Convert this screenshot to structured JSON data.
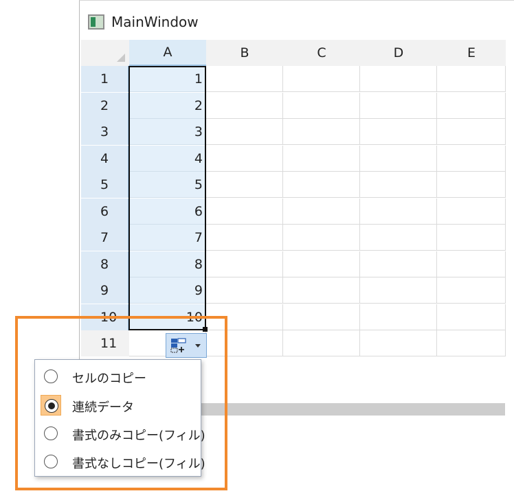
{
  "window": {
    "title": "MainWindow"
  },
  "sheet": {
    "columns": [
      "A",
      "B",
      "C",
      "D",
      "E"
    ],
    "rows": [
      "1",
      "2",
      "3",
      "4",
      "5",
      "6",
      "7",
      "8",
      "9",
      "10",
      "11"
    ],
    "column_a_values": [
      "1",
      "2",
      "3",
      "4",
      "5",
      "6",
      "7",
      "8",
      "9",
      "10"
    ],
    "selected_column": "A"
  },
  "autofill": {
    "button_icon": "autofill-options-icon",
    "options": [
      {
        "label": "セルのコピー",
        "checked": false
      },
      {
        "label": "連続データ",
        "checked": true
      },
      {
        "label": "書式のみコピー(フィル)",
        "checked": false
      },
      {
        "label": "書式なしコピー(フィル)",
        "checked": false
      }
    ]
  },
  "colors": {
    "highlight": "#f28a2e",
    "selection": "#e4f0fa",
    "radio_checked": "#fbc78a"
  }
}
